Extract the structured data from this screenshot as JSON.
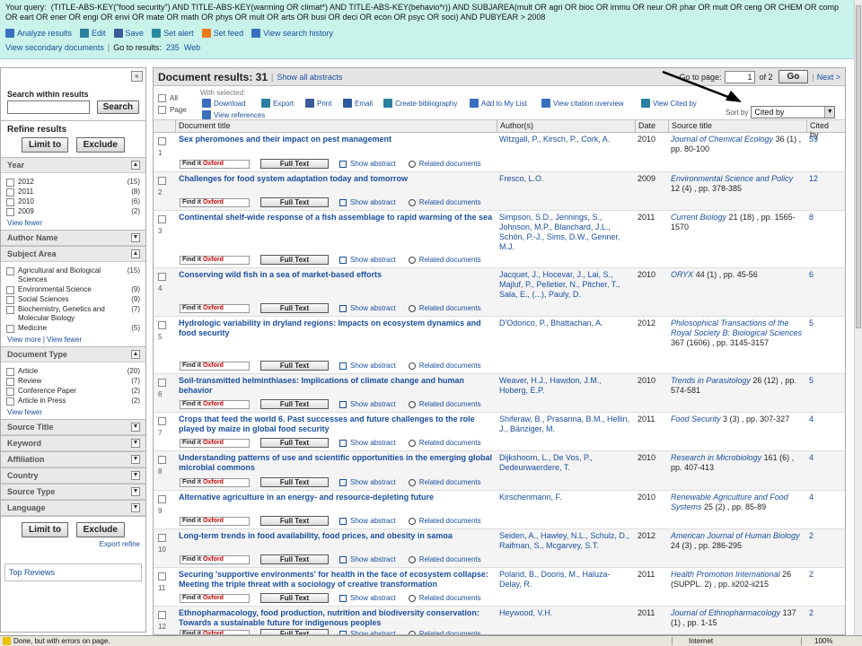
{
  "query": {
    "label": "Your query:",
    "text": "(TITLE-ABS-KEY(\"food security\") AND TITLE-ABS-KEY(warming OR climat*) AND TITLE-ABS-KEY(behavio*r)) AND SUBJAREA(mult OR agri OR bioc OR immu OR neur OR phar OR mult OR ceng OR CHEM OR comp OR eart OR ener OR engi OR envi OR mate OR math OR phys OR mult OR arts OR busi OR deci OR econ OR psyc OR soci) AND PUBYEAR > 2008"
  },
  "tools": [
    "Analyze results",
    "Edit",
    "Save",
    "Set alert",
    "Set feed",
    "View search history"
  ],
  "view_secondary": "View secondary documents",
  "goto_results_label": "Go to results:",
  "goto_results": [
    "235",
    "Web"
  ],
  "left": {
    "search_within": "Search within results",
    "search_btn": "Search",
    "refine": "Refine results",
    "limit": "Limit to",
    "exclude": "Exclude",
    "year": {
      "title": "Year",
      "items": [
        {
          "label": "2012",
          "count": "(15)"
        },
        {
          "label": "2011",
          "count": "(8)"
        },
        {
          "label": "2010",
          "count": "(6)"
        },
        {
          "label": "2009",
          "count": "(2)"
        }
      ]
    },
    "view_fewer": "View fewer",
    "author_name": "Author Name",
    "subject_area": {
      "title": "Subject Area",
      "items": [
        {
          "label": "Agricultural and Biological Sciences",
          "count": "(15)"
        },
        {
          "label": "Environmental Science",
          "count": "(9)"
        },
        {
          "label": "Social Sciences",
          "count": "(9)"
        },
        {
          "label": "Biochemistry, Genetics and Molecular Biology",
          "count": "(7)"
        },
        {
          "label": "Medicine",
          "count": "(5)"
        }
      ]
    },
    "view_more_fewer": "View more | View fewer",
    "doc_type": {
      "title": "Document Type",
      "items": [
        {
          "label": "Article",
          "count": "(20)"
        },
        {
          "label": "Review",
          "count": "(7)"
        },
        {
          "label": "Conference Paper",
          "count": "(2)"
        },
        {
          "label": "Article in Press",
          "count": "(2)"
        }
      ]
    },
    "collapsed": [
      "Source Title",
      "Keyword",
      "Affiliation",
      "Country",
      "Source Type",
      "Language"
    ],
    "export_refine": "Export refine",
    "top_reviews": "Top Reviews"
  },
  "main": {
    "results_label": "Document results: 31",
    "show_abstracts": "Show all abstracts",
    "goto_page": "Go to page:",
    "page": "1",
    "of": "of 2",
    "go": "Go",
    "next": "Next >",
    "all": "All",
    "page_lbl": "Page",
    "with_selected": "With selected:",
    "actions": [
      "Download",
      "Export",
      "Print",
      "Email",
      "Create bibliography",
      "Add to My List",
      "View citation overview",
      "View Cited by",
      "View references"
    ],
    "sort_by": "Sort by",
    "sort_value": "Cited by",
    "columns": [
      "Document title",
      "Author(s)",
      "Date",
      "Source title",
      "Cited by"
    ],
    "find_it": "Find it",
    "oxford": "Oxford",
    "full_text": "Full Text",
    "show_abstract": "Show abstract",
    "related": "Related documents",
    "rows": [
      {
        "n": "1",
        "title": "Sex pheromones and their impact on pest management",
        "authors": "Witzgall, P., Kirsch, P., Cork, A.",
        "date": "2010",
        "journal": "Journal of Chemical Ecology",
        "details": "36 (1) , pp. 80-100",
        "cited": "59"
      },
      {
        "n": "2",
        "title": "Challenges for food system adaptation today and tomorrow",
        "authors": "Fresco, L.O.",
        "date": "2009",
        "journal": "Environmental Science and Policy",
        "details": "12 (4) , pp. 378-385",
        "cited": "12"
      },
      {
        "n": "3",
        "title": "Continental shelf-wide response of a fish assemblage to rapid warming of the sea",
        "authors": "Simpson, S.D., Jennings, S., Johnson, M.P., Blanchard, J.L., Schön, P.-J., Sims, D.W., Genner, M.J.",
        "date": "2011",
        "journal": "Current Biology",
        "details": "21 (18) , pp. 1565-1570",
        "cited": "8"
      },
      {
        "n": "4",
        "title": "Conserving wild fish in a sea of market-based efforts",
        "authors": "Jacquet, J., Hocevar, J., Lai, S., Majluf, P., Pelletier, N., Pitcher, T., Sala, E., (...), Pauly, D.",
        "date": "2010",
        "journal": "ORYX",
        "details": "44 (1) , pp. 45-56",
        "cited": "6"
      },
      {
        "n": "5",
        "title": "Hydrologic variability in dryland regions: Impacts on ecosystem dynamics and food security",
        "authors": "D'Odorico, P., Bhattachan, A.",
        "date": "2012",
        "journal": "Philosophical Transactions of the Royal Society B: Biological Sciences",
        "details": "367 (1606) , pp. 3145-3157",
        "cited": "5"
      },
      {
        "n": "6",
        "title": "Soil-transmitted helminthiases: Implications of climate change and human behavior",
        "authors": "Weaver, H.J., Hawdon, J.M., Hoberg, E.P.",
        "date": "2010",
        "journal": "Trends in Parasitology",
        "details": "26 (12) , pp. 574-581",
        "cited": "5"
      },
      {
        "n": "7",
        "title": "Crops that feed the world 6. Past successes and future challenges to the role played by maize in global food security",
        "authors": "Shiferaw, B., Prasanna, B.M., Hellin, J., Bänziger, M.",
        "date": "2011",
        "journal": "Food Security",
        "details": "3 (3) , pp. 307-327",
        "cited": "4"
      },
      {
        "n": "8",
        "title": "Understanding patterns of use and scientific opportunities in the emerging global microbial commons",
        "authors": "Dijkshoorn, L., De Vos, P., Dedeurwaerdere, T.",
        "date": "2010",
        "journal": "Research in Microbiology",
        "details": "161 (6) , pp. 407-413",
        "cited": "4"
      },
      {
        "n": "9",
        "title": "Alternative agriculture in an energy- and resource-depleting future",
        "authors": "Kirschenmann, F.",
        "date": "2010",
        "journal": "Renewable Agriculture and Food Systems",
        "details": "25 (2) , pp. 85-89",
        "cited": "4"
      },
      {
        "n": "10",
        "title": "Long-term trends in food availability, food prices, and obesity in samoa",
        "authors": "Seiden, A., Hawley, N.L., Schulz, D., Raifman, S., Mcgarvey, S.T.",
        "date": "2012",
        "journal": "American Journal of Human Biology",
        "details": "24 (3) , pp. 286-295",
        "cited": "2"
      },
      {
        "n": "11",
        "title": "Securing 'supportive environments' for health in the face of ecosystem collapse: Meeting the triple threat with a sociology of creative transformation",
        "authors": "Poland, B., Dooris, M., Haluza-Delay, R.",
        "date": "2011",
        "journal": "Health Promotion International",
        "details": "26 (SUPPL. 2) , pp. ii202-ii215",
        "cited": "2"
      },
      {
        "n": "12",
        "title": "Ethnopharmacology, food production, nutrition and biodiversity conservation: Towards a sustainable future for indigenous peoples",
        "authors": "Heywood, V.H.",
        "date": "2011",
        "journal": "Journal of Ethnopharmacology",
        "details": "137 (1) , pp. 1-15",
        "cited": "2"
      }
    ]
  },
  "status": {
    "text": "Done, but with errors on page.",
    "zone": "Internet",
    "zoom": "100%"
  },
  "colors": {
    "topbar": "#c9f2ea",
    "link": "#1a4fa0"
  },
  "icons": [
    "analyze-icon",
    "edit-icon",
    "save-icon",
    "alert-icon",
    "feed-icon",
    "history-icon",
    "download-icon",
    "export-icon",
    "print-icon",
    "email-icon",
    "bibliography-icon",
    "add-list-icon",
    "citation-icon",
    "cited-by-icon",
    "magnifier-icon",
    "warning-icon",
    "globe-icon"
  ]
}
